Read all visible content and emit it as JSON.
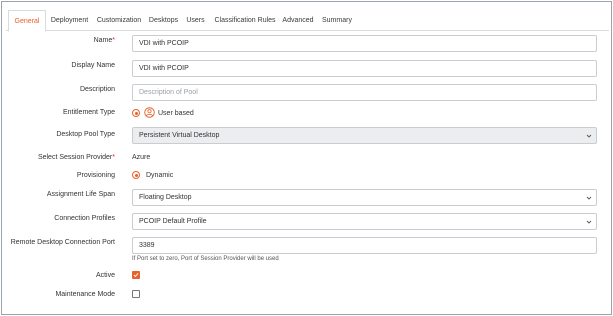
{
  "tabs": [
    {
      "label": "General",
      "active": true
    },
    {
      "label": "Deployment",
      "active": false
    },
    {
      "label": "Customization",
      "active": false
    },
    {
      "label": "Desktops",
      "active": false
    },
    {
      "label": "Users",
      "active": false
    },
    {
      "label": "Classification Rules",
      "active": false
    },
    {
      "label": "Advanced",
      "active": false
    },
    {
      "label": "Summary",
      "active": false
    }
  ],
  "form": {
    "name": {
      "label": "Name",
      "required_mark": "*",
      "value": "VDI with PCOIP"
    },
    "display_name": {
      "label": "Display Name",
      "value": "VDI with PCOIP"
    },
    "description": {
      "label": "Description",
      "placeholder": "Description of Pool"
    },
    "entitlement_type": {
      "label": "Entitlement Type",
      "option": "User based"
    },
    "desktop_pool_type": {
      "label": "Desktop Pool Type",
      "value": "Persistent Virtual Desktop"
    },
    "session_provider": {
      "label": "Select Session Provider",
      "required_mark": "*",
      "value": "Azure"
    },
    "provisioning": {
      "label": "Provisioning",
      "option": "Dynamic"
    },
    "assignment_life_span": {
      "label": "Assignment Life Span",
      "value": "Floating Desktop"
    },
    "connection_profiles": {
      "label": "Connection Profiles",
      "value": "PCOIP Default Profile"
    },
    "rdp_port": {
      "label": "Remote Desktop Connection Port",
      "value": "3389",
      "hint": "If Port set to zero, Port of Session Provider will be used"
    },
    "active": {
      "label": "Active",
      "checked": true
    },
    "maintenance_mode": {
      "label": "Maintenance Mode",
      "checked": false
    }
  },
  "colors": {
    "accent": "#e8622e",
    "required": "#e0252a",
    "border": "#c9cdd2"
  },
  "icons": {
    "select_arrow": "chevron-down-icon",
    "user": "user-circle-icon"
  }
}
